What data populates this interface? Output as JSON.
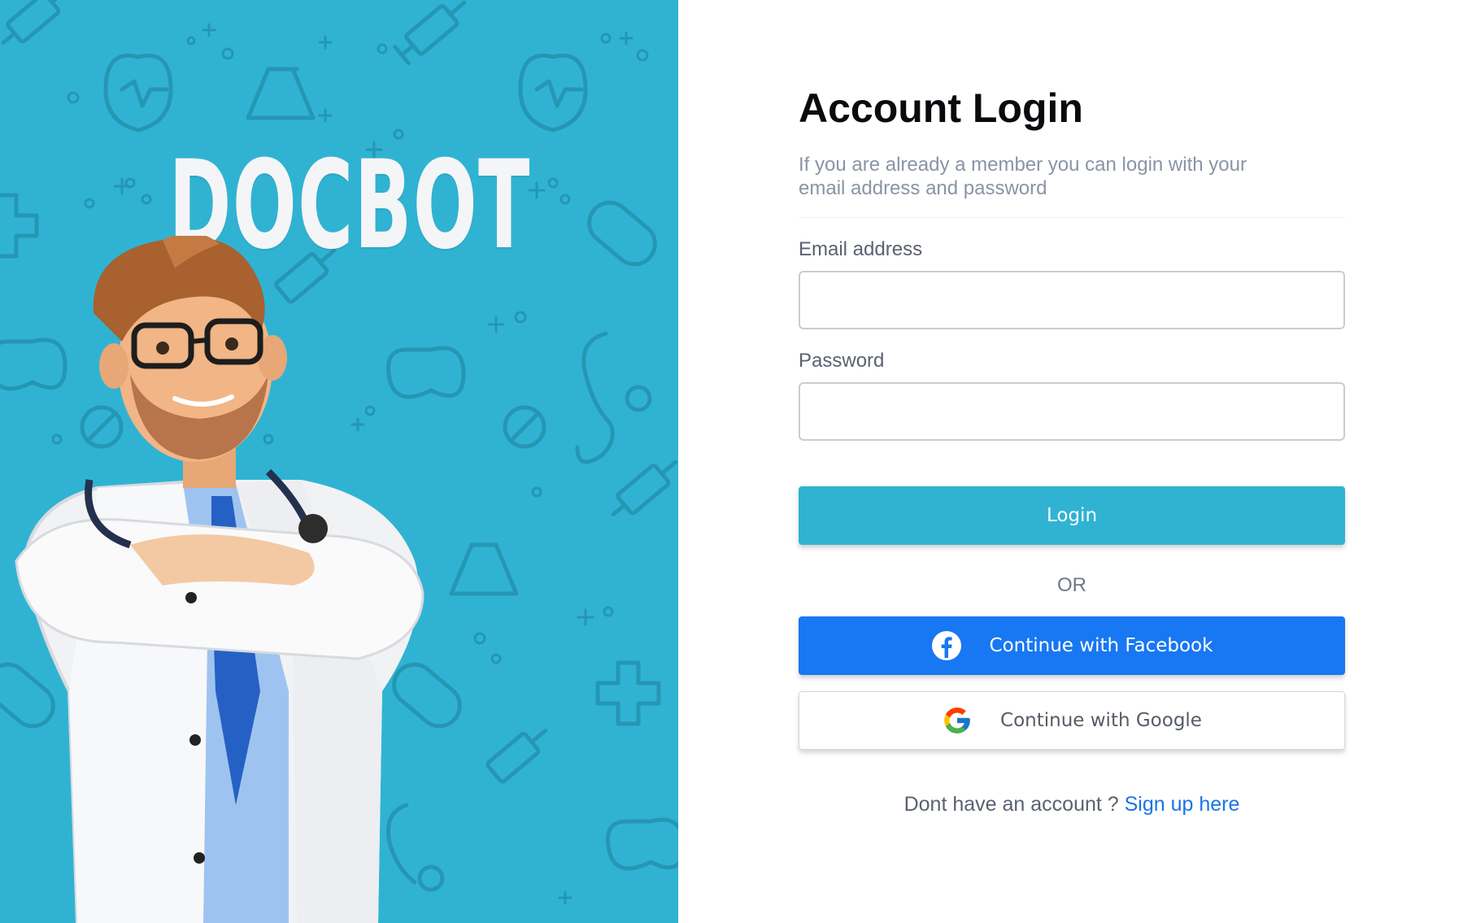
{
  "brand": {
    "name": "DOCBOT"
  },
  "login": {
    "title": "Account Login",
    "subtitle": "If you are already a member you can login with your email address and password",
    "email_label": "Email address",
    "email_value": "",
    "password_label": "Password",
    "password_value": "",
    "login_button": "Login",
    "or_text": "OR",
    "facebook_button": "Continue with Facebook",
    "google_button": "Continue with Google",
    "signup_prompt": "Dont have an account ?",
    "signup_link": "Sign up here"
  },
  "colors": {
    "brand_teal": "#30b3d3",
    "facebook_blue": "#1877f2",
    "link_blue": "#1a73e8",
    "title_dark": "#0b0b0f"
  },
  "icons": {
    "facebook": "facebook-icon",
    "google": "google-icon",
    "doctor": "doctor-mascot-illustration"
  }
}
